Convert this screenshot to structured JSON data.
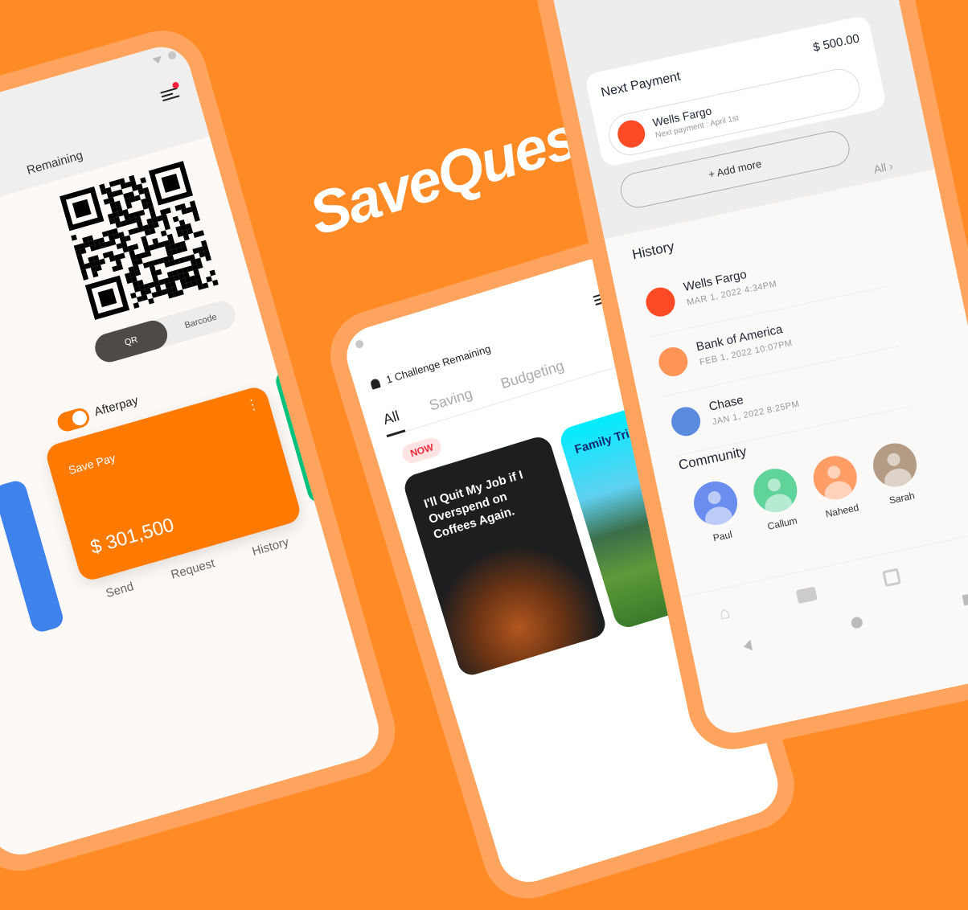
{
  "brand": {
    "logo": "SaveQuest",
    "background": "#ff8a26"
  },
  "wallet_phone": {
    "header": {
      "banner": "Remaining"
    },
    "qr_toggle": {
      "options": [
        "QR",
        "Barcode"
      ],
      "selected": "QR"
    },
    "afterpay": {
      "label": "Afterpay",
      "enabled": true
    },
    "card": {
      "name": "Save Pay",
      "balance": "$ 301,500",
      "color": "#ff7a00"
    },
    "actions": [
      "Send",
      "Request",
      "History"
    ]
  },
  "challenge_phone": {
    "header": {
      "challenges": "1 Challenge Remaining"
    },
    "tabs": [
      "All",
      "Saving",
      "Budgeting"
    ],
    "active_tab": "All",
    "badge": "NOW",
    "cards": [
      {
        "title": "I'll Quit My Job if I Overspend on Coffees Again."
      },
      {
        "title": "Family Trip for My Next Vacation"
      }
    ]
  },
  "payments_phone": {
    "next_payment": {
      "label": "Next Payment",
      "amount": "$ 500.00",
      "payee": "Wells Fargo",
      "detail": "Next payment : April 1st",
      "add_more": "+ Add more"
    },
    "all_link": "All",
    "history": {
      "title": "History",
      "items": [
        {
          "name": "Wells Fargo",
          "date": "MAR 1, 2022 4:34PM",
          "color": "#ff4a26"
        },
        {
          "name": "Bank of America",
          "date": "FEB 1, 2022 10:07PM",
          "color": "#ff9457"
        },
        {
          "name": "Chase",
          "date": "JAN 1, 2022 8:25PM",
          "color": "#5b8bde"
        }
      ]
    },
    "community": {
      "title": "Community",
      "people": [
        {
          "name": "Paul",
          "color": "#6b8df0"
        },
        {
          "name": "Callum",
          "color": "#5fd39a"
        },
        {
          "name": "Naheed",
          "color": "#ff9d66"
        },
        {
          "name": "Sarah",
          "color": "#b49b86"
        }
      ]
    }
  }
}
